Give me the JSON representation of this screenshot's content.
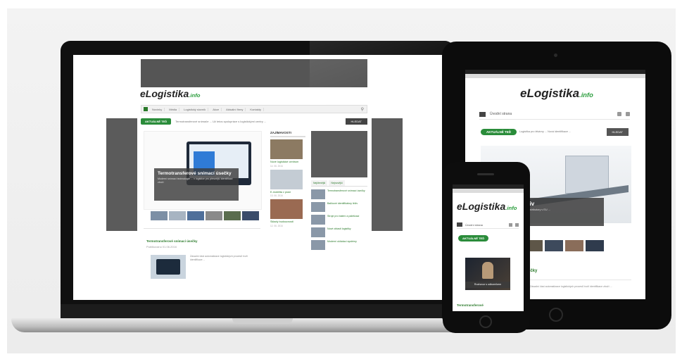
{
  "brand": {
    "logo_main": "eLogistika",
    "logo_suffix": ".info"
  },
  "laptop": {
    "nav_items": [
      "Novinky",
      "Média",
      "Logistický slovník",
      "Akce",
      "Aktuální firmy",
      "Kontakty"
    ],
    "ticker_tag": "AKTUÁLNĚ TEĎ",
    "ticker_text": "Termotransferové snímače ... Už letos spolupráce s logistickými centry ...",
    "ticker_button": "HLEDAT",
    "hero_title": "Termotransferové snímací úsečky",
    "hero_text": "Moderní snímací technologie ... v logistice pro přesnější identifikaci zboží",
    "sidebar_heading": "ZAJÍMAVOSTI",
    "article_title": "Termotransferové snímací úsečky",
    "article_meta": "Publikováno 01.06.2016",
    "article_text": "Zásadní část automatizace logistických procesů tvoří identifikace ...",
    "col2_items": [
      {
        "text": "Nové logistické centrum",
        "date": "14. 06. 2016"
      },
      {
        "text": "E-mobilita v praxi",
        "date": "13. 06. 2016"
      },
      {
        "text": "Sklady budoucnosti",
        "date": "12. 06. 2016"
      }
    ],
    "col3_tabs": [
      "Nejčtenější",
      "Nejnovější"
    ],
    "col3_items": [
      "Termotransferové snímací úsečky",
      "Balíkové identifikátory léčiv",
      "Stroje pro balení a paletizaci",
      "Nové oblasti logistiky",
      "Moderní ukládací systémy"
    ]
  },
  "tablet": {
    "menu_label": "Úvodní strana",
    "ticker_tag": "AKTUÁLNĚ TEĎ",
    "ticker_text": "Logistika pro lékárny ... Nová identifikace ...",
    "ticker_button": "HLEDAT",
    "hero_title": "identifikátory léčiv",
    "hero_text": "Nové povinnosti pro výrobce léčiv a distributory v EU ...",
    "section_title": "snímací úsečky",
    "section_text": "Zásadní část automatizace logistických procesů tvoří identifikace zboží ..."
  },
  "phone": {
    "menu_label": "Úvodní strana",
    "ticker_tag": "AKTUÁLNĚ TEĎ",
    "photo_caption": "Rozhovor s odborníkem",
    "section_title": "Termotransferové"
  }
}
